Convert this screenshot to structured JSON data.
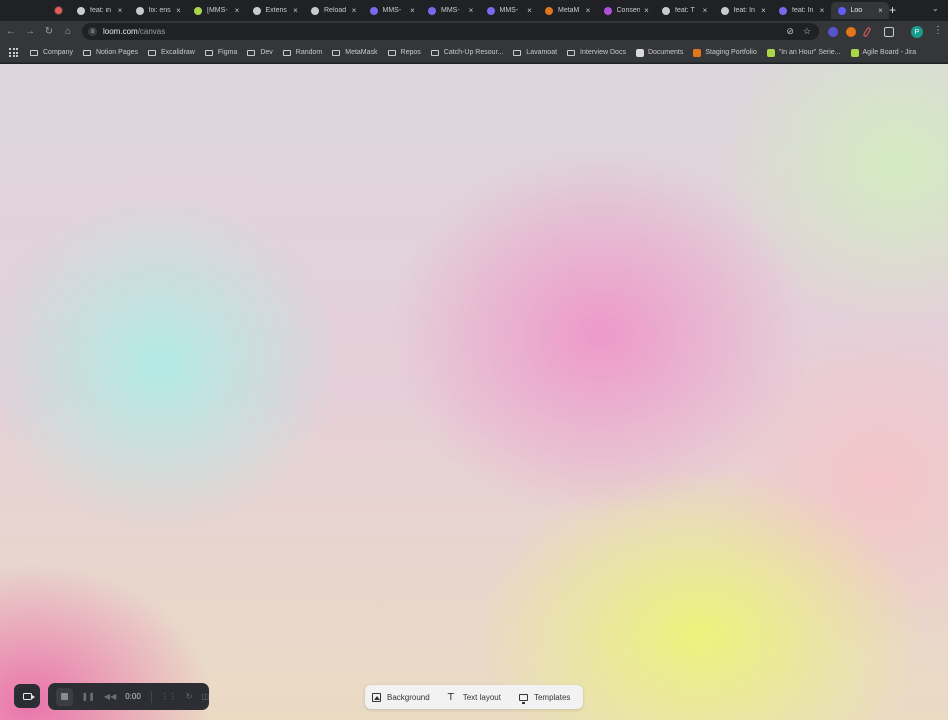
{
  "browser": {
    "tabs": [
      {
        "label": "feat: in",
        "icon": "github-icon",
        "color": "#c9cacd"
      },
      {
        "label": "fix: ens",
        "icon": "github-icon",
        "color": "#c9cacd"
      },
      {
        "label": "[MMS-",
        "icon": "jira-green-icon",
        "color": "#a8d84a"
      },
      {
        "label": "Extens",
        "icon": "puzzle-icon",
        "color": "#c9cacd"
      },
      {
        "label": "Reload",
        "icon": "github-icon",
        "color": "#c9cacd"
      },
      {
        "label": "MMS-",
        "icon": "atlassian-icon",
        "color": "#7b68ee"
      },
      {
        "label": "MMS-",
        "icon": "atlassian-icon",
        "color": "#7b68ee"
      },
      {
        "label": "MMS-",
        "icon": "atlassian-icon",
        "color": "#7b68ee"
      },
      {
        "label": "MetaM",
        "icon": "metamask-fox-icon",
        "color": "#e2761b"
      },
      {
        "label": "Consen",
        "icon": "consensys-icon",
        "color": "#b44fd8"
      },
      {
        "label": "feat: T",
        "icon": "github-icon",
        "color": "#c9cacd"
      },
      {
        "label": "feat: In",
        "icon": "github-icon",
        "color": "#c9cacd"
      },
      {
        "label": "feat: In",
        "icon": "atlassian-icon",
        "color": "#7b68ee"
      },
      {
        "label": "Loo",
        "icon": "loom-icon",
        "color": "#625df5",
        "active": true
      }
    ],
    "new_tab_label": "+",
    "url_host": "loom.com",
    "url_path": "/canvas",
    "profile_initial": "P",
    "bookmarks": [
      {
        "label": "Company",
        "type": "folder"
      },
      {
        "label": "Notion Pages",
        "type": "folder"
      },
      {
        "label": "Excalidraw",
        "type": "folder"
      },
      {
        "label": "Figma",
        "type": "folder"
      },
      {
        "label": "Dev",
        "type": "folder"
      },
      {
        "label": "Random",
        "type": "folder"
      },
      {
        "label": "MetaMask",
        "type": "folder"
      },
      {
        "label": "Repos",
        "type": "folder"
      },
      {
        "label": "Catch-Up Resour...",
        "type": "folder"
      },
      {
        "label": "Lavamoat",
        "type": "folder"
      },
      {
        "label": "Interview Docs",
        "type": "folder"
      },
      {
        "label": "Documents",
        "type": "site",
        "color": "#d9d9d9"
      },
      {
        "label": "Staging Portfolio",
        "type": "site",
        "color": "#e2761b"
      },
      {
        "label": "\"In an Hour\" Serie...",
        "type": "site",
        "color": "#a8d84a"
      },
      {
        "label": "Agile Board - Jira",
        "type": "site",
        "color": "#a8d84a"
      }
    ]
  },
  "recorder": {
    "time": "0:00"
  },
  "layout_bar": {
    "background_label": "Background",
    "text_layout_label": "Text layout",
    "templates_label": "Templates"
  }
}
